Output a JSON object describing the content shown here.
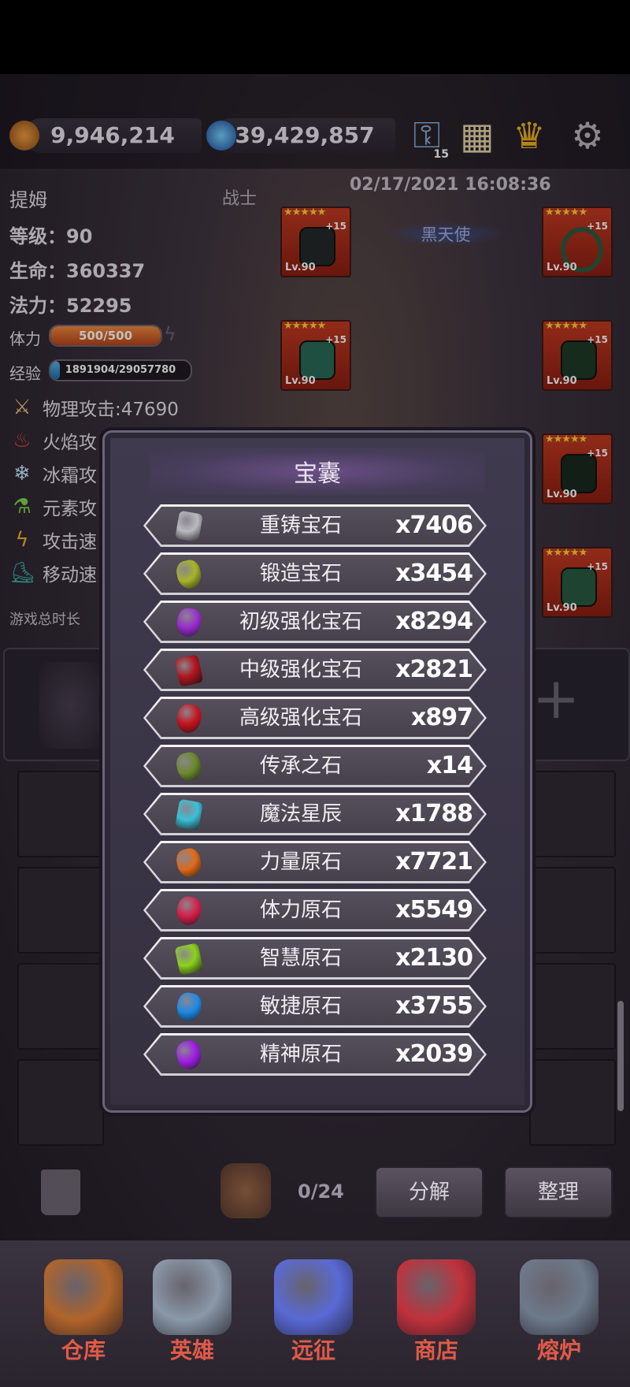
{
  "resources": {
    "gold": "9,946,214",
    "gems": "39,429,857",
    "key_count": "15"
  },
  "icons": {
    "gold": "coin-stack-icon",
    "gem": "blue-gem-icon",
    "key": "key-icon",
    "map": "treasure-map-icon",
    "trophy": "trophy-icon",
    "settings": "gear-icon"
  },
  "hero": {
    "name": "提姆",
    "class": "战士",
    "datetime": "02/17/2021 16:08:36",
    "title": "黑天使",
    "level": "等级：90",
    "hp": "生命：360337",
    "mp": "法力：52295",
    "stamina_label": "体力",
    "stamina_value": "500/500",
    "stamina_fraction": 1.0,
    "exp_label": "经验",
    "exp_value": "1891904/29057780",
    "exp_fraction": 0.065,
    "attributes": [
      {
        "label": "物理攻击:47690",
        "icon": "sword-icon"
      },
      {
        "label": "火焰攻",
        "icon": "fire-icon"
      },
      {
        "label": "冰霜攻",
        "icon": "snowflake-icon"
      },
      {
        "label": "元素攻",
        "icon": "flask-icon"
      },
      {
        "label": "攻击速",
        "icon": "lightning-icon"
      },
      {
        "label": "移动速",
        "icon": "boot-icon"
      }
    ],
    "playtime_label": "游戏总时长"
  },
  "equipment": [
    {
      "stars": "★★★★★",
      "plus": "+15",
      "level": "Lv.90",
      "icon": "helmet-icon"
    },
    {
      "stars": "★★★★★",
      "plus": "+15",
      "level": "Lv.90",
      "icon": "bracelet-icon"
    },
    {
      "stars": "★★★★★",
      "plus": "+15",
      "level": "Lv.90",
      "icon": "amulet-icon"
    },
    {
      "stars": "★★★★★",
      "plus": "+15",
      "level": "Lv.90",
      "icon": "armor-icon"
    },
    {
      "stars": "★★★★★",
      "plus": "+15",
      "level": "Lv.90",
      "icon": "boots-icon"
    },
    {
      "stars": "★★★★★",
      "plus": "+15",
      "level": "Lv.90",
      "icon": "gauntlet-icon"
    }
  ],
  "inventory": {
    "count": "0/24",
    "decompose": "分解",
    "sort": "整理"
  },
  "modal": {
    "title": "宝囊",
    "items": [
      {
        "name": "重铸宝石",
        "count": "x7406",
        "icon": "anvil-stone-icon",
        "color": "#b9b9c0"
      },
      {
        "name": "锻造宝石",
        "count": "x3454",
        "icon": "green-bar-icon",
        "color": "#a8b428"
      },
      {
        "name": "初级强化宝石",
        "count": "x8294",
        "icon": "purple-gems-icon",
        "color": "#9a2ccf"
      },
      {
        "name": "中级强化宝石",
        "count": "x2821",
        "icon": "red-hexagon-gem-icon",
        "color": "#b0141e"
      },
      {
        "name": "高级强化宝石",
        "count": "x897",
        "icon": "red-round-gem-icon",
        "color": "#c8141e"
      },
      {
        "name": "传承之石",
        "count": "x14",
        "icon": "green-rock-icon",
        "color": "#6b8a2c"
      },
      {
        "name": "魔法星辰",
        "count": "x1788",
        "icon": "cyan-star-dust-icon",
        "color": "#3cc0d6"
      },
      {
        "name": "力量原石",
        "count": "x7721",
        "icon": "orange-crystal-icon",
        "color": "#e06a1a"
      },
      {
        "name": "体力原石",
        "count": "x5549",
        "icon": "red-crystal-icon",
        "color": "#d61e4a"
      },
      {
        "name": "智慧原石",
        "count": "x2130",
        "icon": "green-crystal-icon",
        "color": "#8cd21e"
      },
      {
        "name": "敏捷原石",
        "count": "x3755",
        "icon": "blue-crystal-icon",
        "color": "#1e8ae6"
      },
      {
        "name": "精神原石",
        "count": "x2039",
        "icon": "purple-crystal-icon",
        "color": "#a01ee6"
      }
    ]
  },
  "nav": [
    {
      "label": "仓库",
      "icon": "bag-icon",
      "color": "#b0642a"
    },
    {
      "label": "英雄",
      "icon": "helmet-icon",
      "color": "#8a98a8"
    },
    {
      "label": "远征",
      "icon": "portal-castle-icon",
      "color": "#5a6ad6"
    },
    {
      "label": "商店",
      "icon": "shop-icon",
      "color": "#c0323c"
    },
    {
      "label": "熔炉",
      "icon": "anvil-icon",
      "color": "#6e7a8a"
    }
  ]
}
